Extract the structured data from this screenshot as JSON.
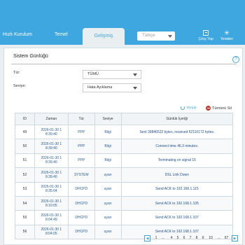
{
  "nav": {
    "quick_setup": "Hızlı Kurulum",
    "basic": "Temel",
    "advanced": "Gelişmiş",
    "language": "Türkçe",
    "logout": "Çıkış Yap",
    "reboot": "Yeniden"
  },
  "section": {
    "title": "Sistem Günlüğü"
  },
  "filters": {
    "type_label": "Tür:",
    "type_value": "TÜMÜ",
    "level_label": "Seviye:",
    "level_value": "Hata Ayıklama"
  },
  "actions": {
    "refresh": "Yenile",
    "clear_all": "Tümünü Sil"
  },
  "table": {
    "headers": {
      "id": "ID",
      "time": "Zaman",
      "type": "Tür",
      "level": "Seviye",
      "content": "Günlük İçeriği"
    },
    "rows": [
      {
        "id": "49",
        "date": "2026-01-30 1",
        "time": "8:39:40",
        "type": "PPP",
        "level": "Bilgi",
        "content": "Sent 39846522 bytes, received 52110172 bytes."
      },
      {
        "id": "50",
        "date": "2026-01-30 1",
        "time": "8:39:40",
        "type": "PPP",
        "level": "Bilgi",
        "content": "Connect time 46.3 minutes."
      },
      {
        "id": "51",
        "date": "2026-01-30 1",
        "time": "8:39:40",
        "type": "PPP",
        "level": "Bilgi",
        "content": "Terminating on signal 15"
      },
      {
        "id": "52",
        "date": "2026-01-30 1",
        "time": "8:39:40",
        "type": "SYSTEM",
        "level": "uyarı",
        "content": "DSL Link Down"
      },
      {
        "id": "53",
        "date": "2026-01-30 1",
        "time": "8:35:04",
        "type": "DHCPD",
        "level": "uyarı",
        "content": "Send ACK to 192.168.1.115"
      },
      {
        "id": "54",
        "date": "2026-01-30 1",
        "time": "8:10:05",
        "type": "DHCPD",
        "level": "uyarı",
        "content": "Send ACK to 192.168.1.105"
      },
      {
        "id": "55",
        "date": "2026-01-30 1",
        "time": "8:04:49",
        "type": "DHCPD",
        "level": "uyarı",
        "content": "Send ACK to 192.168.1.107"
      },
      {
        "id": "56",
        "date": "2026-01-30 1",
        "time": "8:04:05",
        "type": "DHCPD",
        "level": "uyarı",
        "content": "Send ACK to 192.168.1.107"
      }
    ]
  },
  "pagination": {
    "prev": "◀",
    "pages": [
      "1",
      "...",
      "4",
      "5",
      "6",
      "7",
      "8",
      "9",
      "10",
      "...",
      "67"
    ],
    "next": "▶"
  }
}
